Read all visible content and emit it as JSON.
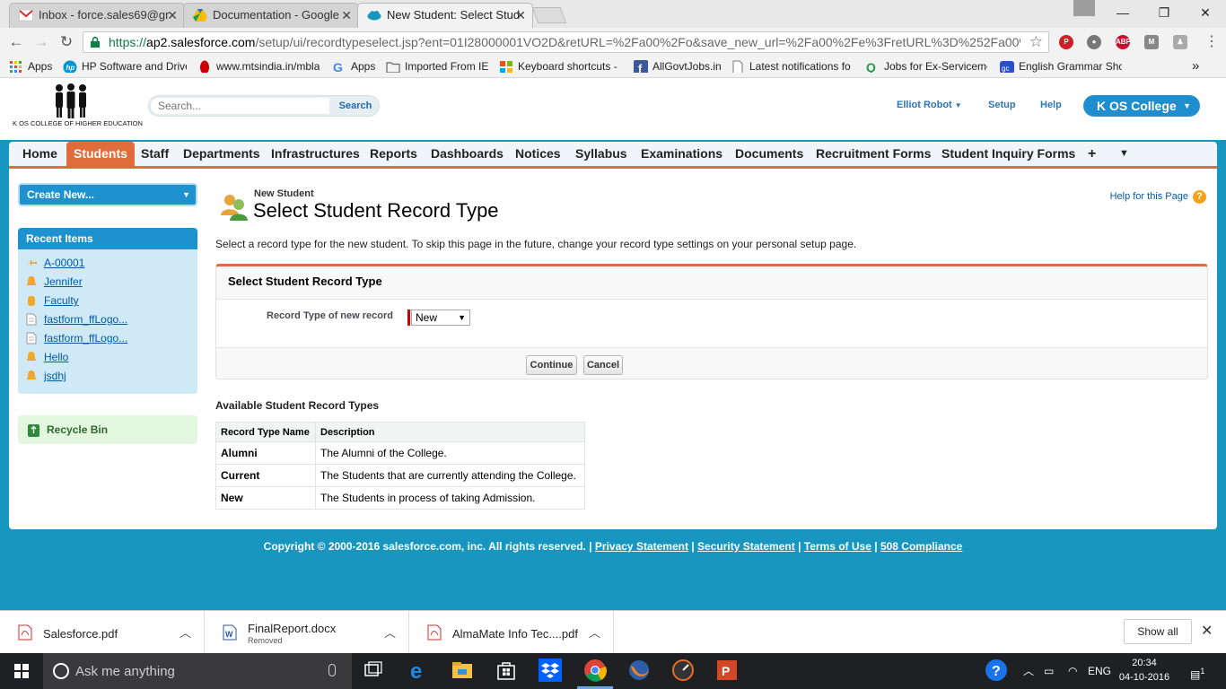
{
  "browser": {
    "tabs": [
      {
        "title": "Inbox - force.sales69@gr",
        "active": false
      },
      {
        "title": "Documentation - Google",
        "active": false
      },
      {
        "title": "New Student: Select Stud",
        "active": true
      }
    ],
    "url_scheme": "https://",
    "url_host": "ap2.salesforce.com",
    "url_rest": "/setup/ui/recordtypeselect.jsp?ent=01I28000001VO2D&retURL=%2Fa00%2Fo&save_new_url=%2Fa00%2Fe%3FretURL%3D%252Fa00%252F",
    "bookmarks": [
      {
        "label": "Apps"
      },
      {
        "label": "HP Software and Drive"
      },
      {
        "label": "www.mtsindia.in/mbla"
      },
      {
        "label": "Apps"
      },
      {
        "label": "Imported From IE"
      },
      {
        "label": "Keyboard shortcuts -"
      },
      {
        "label": "AllGovtJobs.in"
      },
      {
        "label": "Latest notifications fo"
      },
      {
        "label": "Jobs for Ex-Serviceme"
      },
      {
        "label": "English Grammar Sho"
      }
    ],
    "more_bookmarks": "»",
    "ext_abp": "ABP"
  },
  "sf": {
    "logo_text": "K OS COLLEGE OF HIGHER EDUCATION",
    "search_placeholder": "Search...",
    "search_button": "Search",
    "user_name": "Elliot Robot",
    "setup": "Setup",
    "help": "Help",
    "app_name": "K OS College",
    "nav_tabs": [
      {
        "label": "Home"
      },
      {
        "label": "Students"
      },
      {
        "label": "Staff"
      },
      {
        "label": "Departments"
      },
      {
        "label": "Infrastructures"
      },
      {
        "label": "Reports"
      },
      {
        "label": "Dashboards"
      },
      {
        "label": "Notices"
      },
      {
        "label": "Syllabus"
      },
      {
        "label": "Examinations"
      },
      {
        "label": "Documents"
      },
      {
        "label": "Recruitment Forms"
      },
      {
        "label": "Student Inquiry Forms"
      }
    ],
    "selected_tab": "Students",
    "sidebar": {
      "create_new": "Create New...",
      "recent_title": "Recent Items",
      "recent_items": [
        {
          "label": "A-00001"
        },
        {
          "label": "Jennifer"
        },
        {
          "label": "Faculty"
        },
        {
          "label": "fastform_ffLogo..."
        },
        {
          "label": "fastform_ffLogo..."
        },
        {
          "label": "Hello"
        },
        {
          "label": "jsdhj"
        }
      ],
      "recycle_bin": "Recycle Bin"
    },
    "page": {
      "type": "New Student",
      "title": "Select Student Record Type",
      "help_link": "Help for this Page",
      "instructions": "Select a record type for the new student. To skip this page in the future, change your record type settings on your personal setup page.",
      "section_title": "Select Student Record Type",
      "field_label": "Record Type of new record",
      "field_value": "New",
      "continue": "Continue",
      "cancel": "Cancel",
      "available_title": "Available Student Record Types",
      "table_headers": [
        "Record Type Name",
        "Description"
      ],
      "table_rows": [
        {
          "name": "Alumni",
          "description": "The Alumni of the College."
        },
        {
          "name": "Current",
          "description": "The Students that are currently attending the College."
        },
        {
          "name": "New",
          "description": "The Students in process of taking Admission."
        }
      ]
    },
    "footer": {
      "copyright": "Copyright © 2000-2016 salesforce.com, inc. All rights reserved. |",
      "privacy": "Privacy Statement",
      "security": "Security Statement",
      "terms": "Terms of Use",
      "compliance": "508 Compliance",
      "sep": "|"
    }
  },
  "downloads": {
    "items": [
      {
        "name": "Salesforce.pdf",
        "status": ""
      },
      {
        "name": "FinalReport.docx",
        "status": "Removed"
      },
      {
        "name": "AlmaMate Info Tec....pdf",
        "status": ""
      }
    ],
    "show_all": "Show all"
  },
  "taskbar": {
    "search_placeholder": "Ask me anything",
    "language": "ENG",
    "time": "20:34",
    "date": "04-10-2016",
    "notifications": "1"
  },
  "colors": {
    "salesforce_blue": "#1797c0",
    "tab_accent": "#e06c3c",
    "link": "#015ba7"
  }
}
